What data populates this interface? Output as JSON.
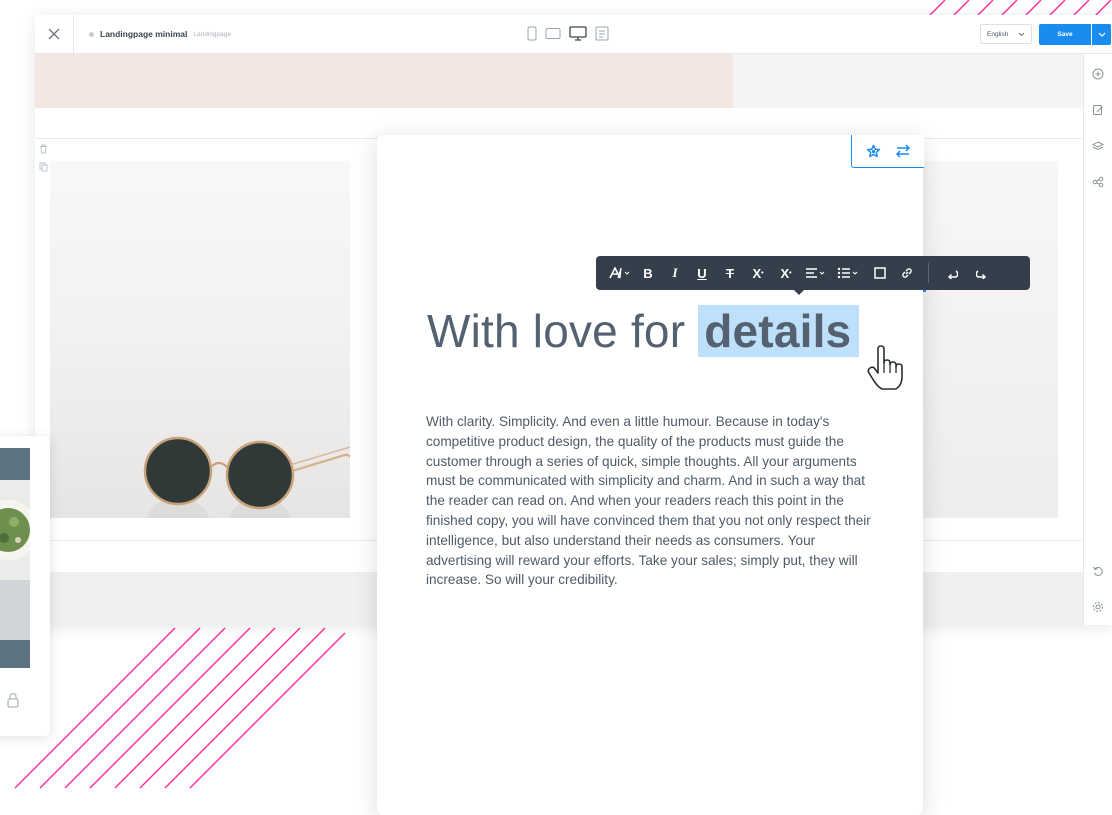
{
  "toolbar": {
    "close_icon": "close-icon",
    "page_title": "Landingpage minimal",
    "page_subtitle": "Landingpage",
    "devices": [
      "phone-icon",
      "tablet-icon",
      "desktop-icon",
      "document-icon"
    ],
    "language": "English",
    "save_label": "Save"
  },
  "sidebar_right": {
    "icons": [
      "add-icon",
      "edit-icon",
      "layers-icon",
      "share-icon",
      "undo-icon",
      "settings-icon"
    ]
  },
  "row_tools": {
    "icons": [
      "trash-icon",
      "duplicate-icon"
    ]
  },
  "card_actions": {
    "icons": [
      "style-icon",
      "swap-icon"
    ]
  },
  "text_toolbar": {
    "font_icon": "font-size-icon",
    "bold": "B",
    "italic": "I",
    "underline": "U",
    "strikethrough": "T",
    "superscript": "X",
    "subscript": "X",
    "icons": [
      "align-icon",
      "list-icon",
      "box-icon",
      "link-icon",
      "undo-icon",
      "redo-icon"
    ]
  },
  "content": {
    "headline_plain": "With love for ",
    "headline_selected": "details",
    "body": "With clarity. Simplicity. And even a little humour. Because in today's competitive product design, the quality of the products must guide the customer through a series of quick, simple thoughts. All your arguments must be communicated with simplicity and charm. And in such a way that the reader can read on. And when your readers reach this point in the finished copy, you will have convinced them that you not only respect their intelligence, but also understand their needs as consumers. Your advertising will reward your efforts. Take your sales; simply put, they will increase. So will your credibility."
  },
  "colors": {
    "accent": "#1a8cf0",
    "toolbar_dark": "#343f4b",
    "selection": "#bfe0fb",
    "decor_pink": "#ff2d9e"
  }
}
